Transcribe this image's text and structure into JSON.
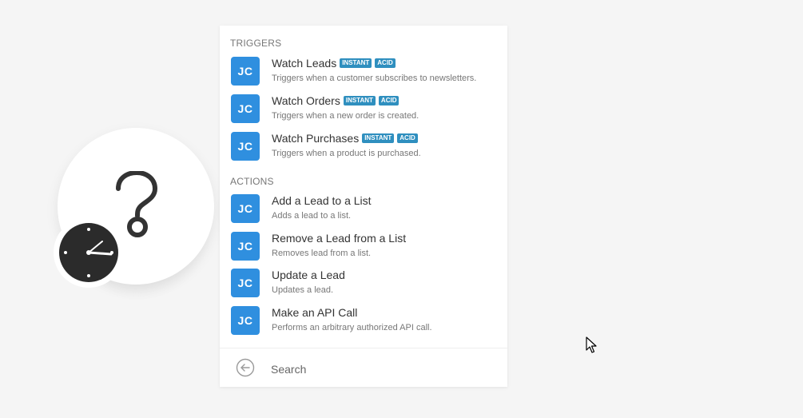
{
  "module": {
    "primary_icon": "question-mark-icon",
    "secondary_icon": "clock-icon"
  },
  "panel": {
    "triggers_title": "TRIGGERS",
    "actions_title": "ACTIONS",
    "app_abbrev": "JC",
    "accent_color": "#2f8fdf",
    "triggers": [
      {
        "title": "Watch Leads",
        "description": "Triggers when a customer subscribes to newsletters.",
        "tags": [
          "INSTANT",
          "ACID"
        ]
      },
      {
        "title": "Watch Orders",
        "description": "Triggers when a new order is created.",
        "tags": [
          "INSTANT",
          "ACID"
        ]
      },
      {
        "title": "Watch Purchases",
        "description": "Triggers when a product is purchased.",
        "tags": [
          "INSTANT",
          "ACID"
        ]
      }
    ],
    "actions": [
      {
        "title": "Add a Lead to a List",
        "description": "Adds a lead to a list."
      },
      {
        "title": "Remove a Lead from a List",
        "description": "Removes lead from a list."
      },
      {
        "title": "Update a Lead",
        "description": "Updates a lead."
      },
      {
        "title": "Make an API Call",
        "description": "Performs an arbitrary authorized API call."
      }
    ],
    "search": {
      "placeholder": "Search",
      "value": ""
    },
    "back_icon": "arrow-left-circle-icon"
  },
  "cursor_icon": "mouse-pointer-icon"
}
